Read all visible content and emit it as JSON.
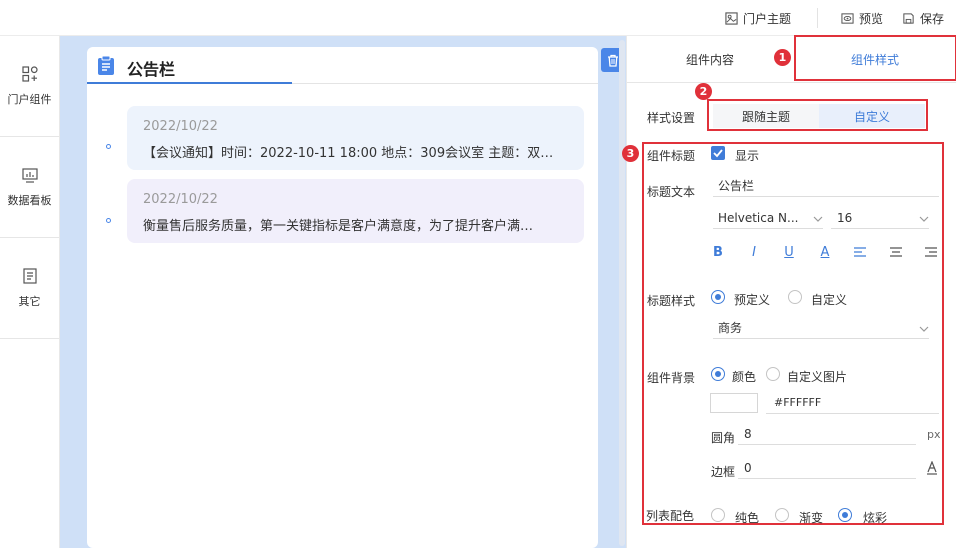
{
  "topbar": {
    "portal_theme": "门户主题",
    "preview": "预览",
    "save": "保存"
  },
  "leftnav": {
    "items": [
      {
        "label": "门户组件",
        "icon": "grid-icon"
      },
      {
        "label": "数据看板",
        "icon": "board-icon"
      },
      {
        "label": "其它",
        "icon": "document-icon"
      }
    ]
  },
  "card": {
    "title": "公告栏",
    "notices": [
      {
        "date": "2022/10/22",
        "text": "【会议通知】时间：2022-10-11 18:00 地点：309会议室 主题：双…"
      },
      {
        "date": "2022/10/22",
        "text": "衡量售后服务质量，第一关键指标是客户满意度，为了提升客户满…"
      }
    ]
  },
  "panel": {
    "tabs": [
      "组件内容",
      "组件样式"
    ],
    "badges": [
      "1",
      "2",
      "3"
    ],
    "style_setting_label": "样式设置",
    "style_options": [
      "跟随主题",
      "自定义"
    ],
    "component_title_label": "组件标题",
    "show_label": "显示",
    "title_text_label": "标题文本",
    "title_text_value": "公告栏",
    "font_family": "Helvetica N...",
    "font_size": "16",
    "format_buttons": [
      "B",
      "I",
      "U",
      "A"
    ],
    "title_style_label": "标题样式",
    "title_style_options": [
      "预定义",
      "自定义"
    ],
    "title_style_preset": "商务",
    "background_label": "组件背景",
    "background_options": [
      "颜色",
      "自定义图片"
    ],
    "background_color": "#FFFFFF",
    "radius_label": "圆角",
    "radius_value": "8",
    "radius_unit": "px",
    "border_label": "边框",
    "border_value": "0",
    "list_color_label": "列表配色",
    "list_color_options": [
      "纯色",
      "渐变",
      "炫彩"
    ]
  },
  "colors": {
    "accent": "#3f7cd8",
    "highlight": "#e0313a",
    "canvas": "#cfe0f7",
    "notice1_bg": "#edf3fc",
    "notice2_bg": "#f1effb"
  }
}
